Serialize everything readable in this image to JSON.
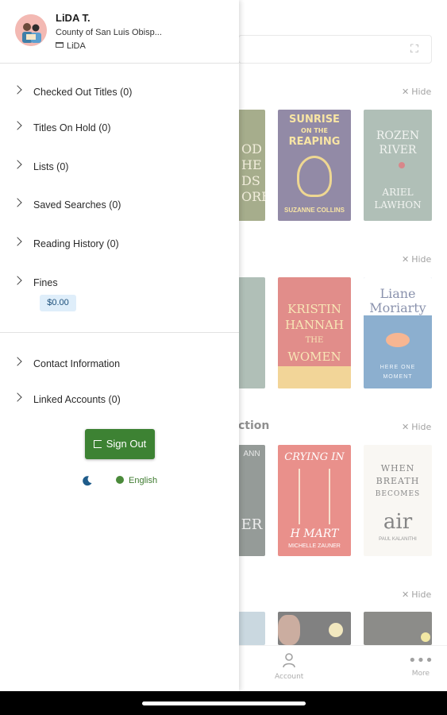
{
  "profile": {
    "name": "LiDA T.",
    "library": "County of San Luis Obisp...",
    "card": "LiDA"
  },
  "menu": {
    "checked_out": "Checked Out Titles (0)",
    "on_hold": "Titles On Hold (0)",
    "lists": "Lists (0)",
    "saved_searches": "Saved Searches (0)",
    "reading_history": "Reading History (0)",
    "fines": "Fines",
    "fines_amount": "$0.00",
    "contact_info": "Contact Information",
    "linked_accounts": "Linked Accounts (0)"
  },
  "actions": {
    "sign_out": "Sign Out",
    "language": "English"
  },
  "background": {
    "hide_label": "Hide",
    "section_title_fragment": "ction",
    "nav": {
      "account": "Account",
      "more": "More"
    },
    "covers": {
      "c1": [
        "OD",
        "HE",
        "DS",
        "ORE"
      ],
      "sunrise": [
        "SUNRISE",
        "ON THE",
        "REAPING",
        "SUZANNE COLLINS"
      ],
      "frozen": [
        "ROZEN",
        "RIVER",
        "ARIEL",
        "LAWHON"
      ],
      "kristin": [
        "KRISTIN",
        "HANNAH",
        "THE",
        "WOMEN"
      ],
      "liane": [
        "Liane",
        "Moriarty",
        "HERE ONE",
        "MOMENT"
      ],
      "crying": [
        "CRYING IN",
        "H MART",
        "MICHELLE ZAUNER"
      ],
      "breath": [
        "WHEN",
        "BREATH",
        "BECOMES",
        "air",
        "PAUL KALANITHI"
      ],
      "c5": [
        "ANN",
        "ER"
      ]
    }
  },
  "colors": {
    "accent_green": "#3d8233",
    "badge_bg": "#dfeefa"
  },
  "icons": {
    "chevron": "chevron-right-icon",
    "moon": "moon-icon",
    "globe": "globe-icon",
    "sign_out": "sign-out-icon",
    "scan": "scan-icon"
  }
}
